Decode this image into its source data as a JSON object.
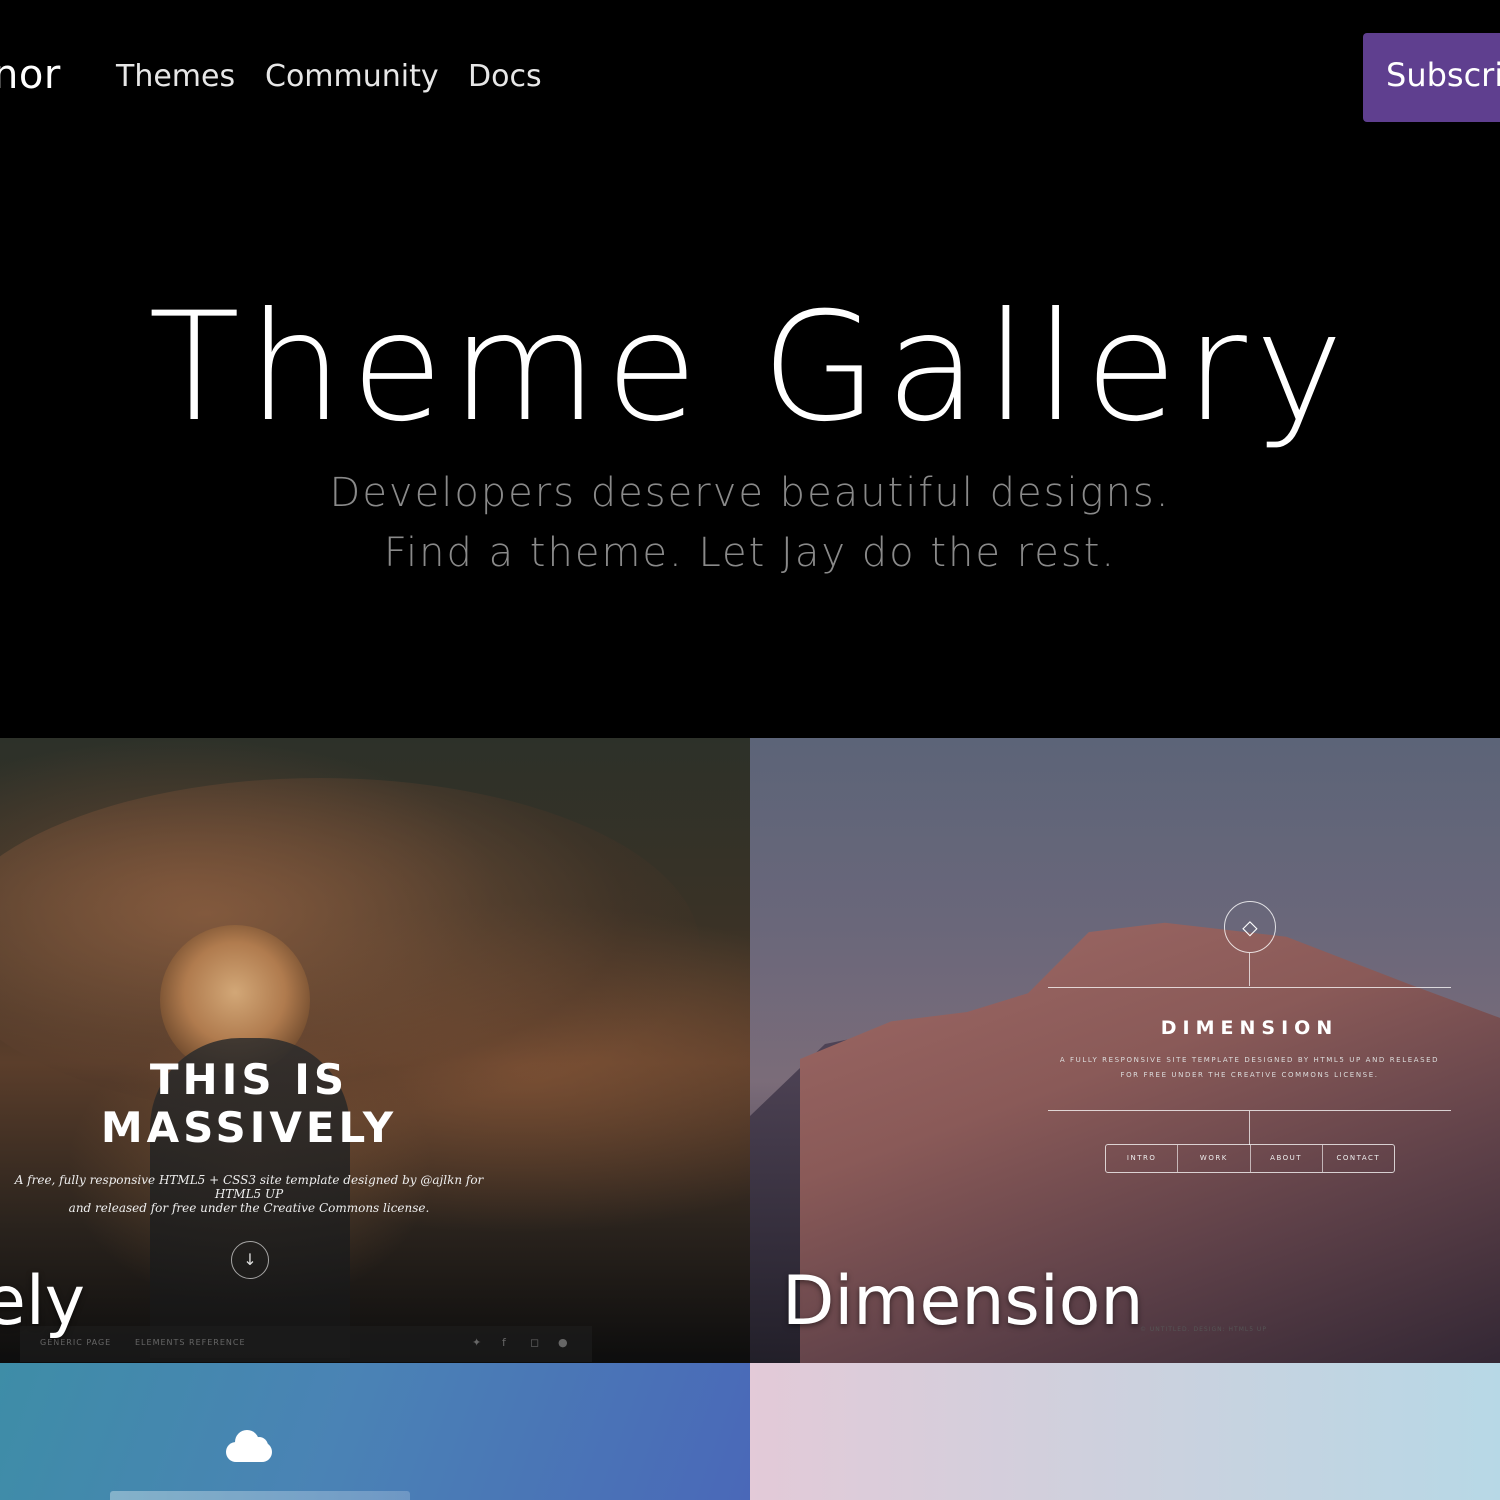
{
  "nav": {
    "brand": "anor",
    "links": [
      {
        "label": "Themes"
      },
      {
        "label": "Community"
      },
      {
        "label": "Docs"
      }
    ],
    "subscribe_label": "Subscribe"
  },
  "hero": {
    "title": "Theme Gallery",
    "subtitle_line1": "Developers deserve beautiful designs.",
    "subtitle_line2": "Find a theme. Let Jay do the rest."
  },
  "cards": {
    "massively": {
      "caption": "ely",
      "preview_title_line1": "THIS IS",
      "preview_title_line2": "MASSIVELY",
      "preview_desc_line1": "A free, fully responsive HTML5 + CSS3 site template designed by @ajlkn for HTML5 UP",
      "preview_desc_line2": "and released for free under the Creative Commons license.",
      "preview_footer_item1": "GENERIC PAGE",
      "preview_footer_item2": "ELEMENTS REFERENCE"
    },
    "dimension": {
      "caption": "Dimension",
      "preview_title": "DIMENSION",
      "preview_desc_line1": "A FULLY RESPONSIVE SITE TEMPLATE DESIGNED BY HTML5 UP AND RELEASED",
      "preview_desc_line2": "FOR FREE UNDER THE CREATIVE COMMONS LICENSE.",
      "preview_nav": [
        "INTRO",
        "WORK",
        "ABOUT",
        "CONTACT"
      ],
      "preview_credit": "© UNTITLED. DESIGN: HTML5 UP"
    }
  },
  "icons": {
    "diamond": "diamond-icon",
    "arrow_down": "arrow-down-icon",
    "cloud": "cloud-icon"
  }
}
